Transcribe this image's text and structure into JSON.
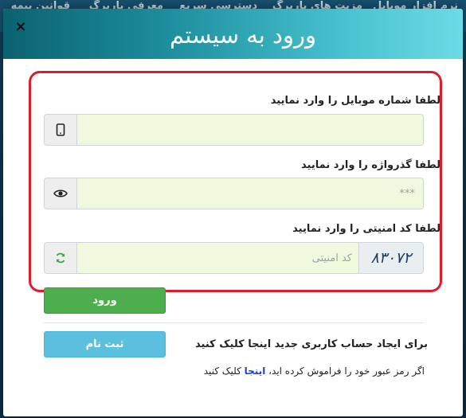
{
  "background": {
    "nav_items": [
      "نرم افزار موبایل",
      "مزیت های باربرگ",
      "دسترسی سریع",
      "معرفی باربرگ",
      "قوانین بیمه"
    ]
  },
  "modal": {
    "title": "ورود به سیستم",
    "close_symbol": "×"
  },
  "form": {
    "mobile_label": "لطفا شماره موبایل را وارد نمایید",
    "mobile_value": "",
    "mobile_placeholder": "",
    "mobile_icon": "mobile-phone-icon",
    "password_label": "لطفا گذرواژه را وارد نمایید",
    "password_value": "",
    "password_placeholder": "***",
    "password_icon": "eye-icon",
    "captcha_label": "لطفا کد امنیتی را وارد نمایید",
    "captcha_value": "",
    "captcha_placeholder": "کد امنیتی",
    "captcha_image_text": "۸۳۰۷۲",
    "refresh_icon": "refresh-icon",
    "login_button": "ورود"
  },
  "register": {
    "prompt": "برای ایجاد حساب کاربری جدید اینجا کلیک کنید",
    "button": "ثبت نام"
  },
  "forgot": {
    "prefix": "اگر رمز عبور خود را فراموش کرده اید،",
    "link": "اینجا",
    "suffix": "کلیک کنید"
  },
  "colors": {
    "header_gradient_start": "#0b6270",
    "header_gradient_end": "#6cdbe4",
    "frame_border": "#e11b2b",
    "input_bg": "#eef9dd",
    "login_button": "#4cae4c",
    "register_button": "#5bc0de",
    "link": "#1a3fd6"
  }
}
